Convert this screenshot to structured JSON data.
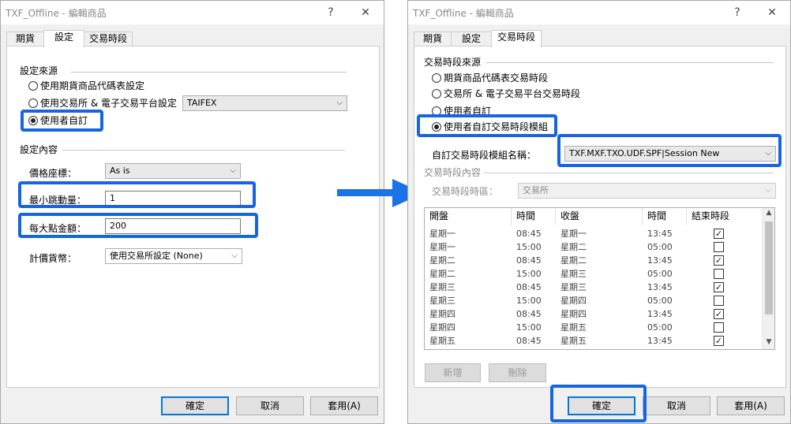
{
  "left": {
    "title": "TXF_Offline - 編輯商品",
    "help": "?",
    "close": "✕",
    "tabs": [
      "期貨",
      "設定",
      "交易時段"
    ],
    "source_section": "設定來源",
    "radio1": "使用期貨商品代碼表設定",
    "radio2": "使用交易所 & 電子交易平台設定",
    "exchange_select": "TAIFEX",
    "radio3": "使用者自訂",
    "content_section": "設定內容",
    "price_label": "價格座標：",
    "price_value": "As is",
    "tick_label": "最小跳動量：",
    "tick_value": "1",
    "point_label": "每大點金額：",
    "point_value": "200",
    "currency_label": "計價貨幣：",
    "currency_value": "使用交易所設定 (None)",
    "ok": "確定",
    "cancel": "取消",
    "apply": "套用(A)"
  },
  "right": {
    "title": "TXF_Offline - 編輯商品",
    "help": "?",
    "close": "✕",
    "tabs": [
      "期貨",
      "設定",
      "交易時段"
    ],
    "source_section": "交易時段來源",
    "radio1": "期貨商品代碼表交易時段",
    "radio2": "交易所 & 電子交易平台交易時段",
    "radio3": "使用者自訂",
    "radio4": "使用者自訂交易時段模組",
    "template_label": "自訂交易時段模組名稱：",
    "template_value": "TXF.MXF.TXO.UDF.SPF|Session New",
    "content_section": "交易時段內容",
    "tz_label": "交易時段時區：",
    "tz_value": "交易所",
    "headers": [
      "開盤",
      "時間",
      "收盤",
      "時間",
      "結束時段"
    ],
    "rows": [
      {
        "open_day": "星期一",
        "open_time": "08:45",
        "close_day": "星期一",
        "close_time": "13:45",
        "end": true
      },
      {
        "open_day": "星期一",
        "open_time": "15:00",
        "close_day": "星期二",
        "close_time": "05:00",
        "end": false
      },
      {
        "open_day": "星期二",
        "open_time": "08:45",
        "close_day": "星期二",
        "close_time": "13:45",
        "end": true
      },
      {
        "open_day": "星期二",
        "open_time": "15:00",
        "close_day": "星期三",
        "close_time": "05:00",
        "end": false
      },
      {
        "open_day": "星期三",
        "open_time": "08:45",
        "close_day": "星期三",
        "close_time": "13:45",
        "end": true
      },
      {
        "open_day": "星期三",
        "open_time": "15:00",
        "close_day": "星期四",
        "close_time": "05:00",
        "end": false
      },
      {
        "open_day": "星期四",
        "open_time": "08:45",
        "close_day": "星期四",
        "close_time": "13:45",
        "end": true
      },
      {
        "open_day": "星期四",
        "open_time": "15:00",
        "close_day": "星期五",
        "close_time": "05:00",
        "end": false
      },
      {
        "open_day": "星期五",
        "open_time": "08:45",
        "close_day": "星期五",
        "close_time": "13:45",
        "end": true
      }
    ],
    "add": "新增",
    "delete": "刪除",
    "ok": "確定",
    "cancel": "取消",
    "apply": "套用(A)"
  },
  "colors": {
    "highlight": "#1565e0",
    "dialog_bg": "#f0f0f0",
    "panel_bg": "#ffffff"
  }
}
